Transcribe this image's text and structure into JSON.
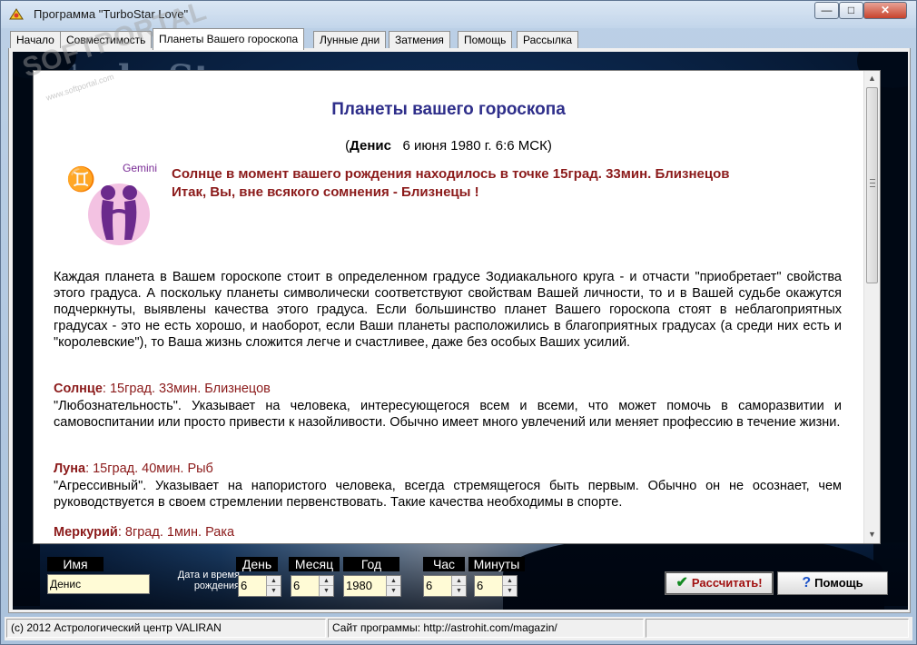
{
  "window": {
    "title": "Программа \"TurboStar Love\"",
    "buttons": {
      "minimize": "—",
      "maximize": "□",
      "close": "✕"
    }
  },
  "watermark": {
    "text": "SOFTPORTAL",
    "sub": "www.softportal.com"
  },
  "tabs": [
    {
      "label": "Начало"
    },
    {
      "label": "Совместимость"
    },
    {
      "label": "Планеты Вашего гороскопа"
    },
    {
      "label": "Лунные дни"
    },
    {
      "label": "Затмения"
    },
    {
      "label": "Помощь"
    },
    {
      "label": "Рассылка"
    }
  ],
  "active_tab": "Планеты Вашего гороскопа",
  "document": {
    "title": "Планеты вашего гороскопа",
    "person_prefix": "(",
    "person_name": "Денис",
    "person_details": "6 июня 1980 г. 6:6 МСК)",
    "sign_glyph": "♊",
    "sign_label": "Gemini",
    "sun_line1": "Солнце в момент вашего рождения находилось в точке 15град. 33мин. Близнецов",
    "sun_line2": "Итак, Вы, вне всякого сомнения - Близнецы !",
    "intro": "Каждая планета в Вашем гороскопе стоит в определенном градусе Зодиакального круга - и отчасти \"приобретает\" свойства этого градуса. А поскольку планеты символически соответствуют свойствам Вашей личности, то и в Вашей судьбе окажутся подчеркнуты, выявлены качества этого градуса. Если большинство планет Вашего гороскопа стоят в неблагоприятных градусах - это не есть хорошо, и наоборот, если Ваши планеты расположились в благоприятных градусах (а среди них есть и \"королевские\"), то Ваша жизнь сложится легче и счастливее, даже без особых Ваших усилий.",
    "planets": [
      {
        "name": "Солнце",
        "position": ": 15град. 33мин. Близнецов",
        "text": "\"Любознательность\". Указывает на человека, интересующегося всем и всеми, что может помочь в саморазвитии и самовоспитании или просто привести к назойливости. Обычно имеет много увлечений или меняет профессию в течение жизни."
      },
      {
        "name": "Луна",
        "position": ": 15град. 40мин. Рыб",
        "text": "\"Агрессивный\". Указывает на напористого человека, всегда стремящегося быть первым. Обычно он не осознает, чем руководствуется в своем стремлении первенствовать. Такие качества необходимы в спорте."
      },
      {
        "name": "Меркурий",
        "position": ": 8град. 1мин. Рака",
        "text": ""
      }
    ]
  },
  "form": {
    "name_label": "Имя",
    "name_value": "Денис",
    "datetime_label": "Дата и время рождения",
    "day_label": "День",
    "day_value": "6",
    "month_label": "Месяц",
    "month_value": "6",
    "year_label": "Год",
    "year_value": "1980",
    "hour_label": "Час",
    "hour_value": "6",
    "minute_label": "Минуты",
    "minute_value": "6",
    "calculate_label": "Рассчитать!",
    "help_label": "Помощь"
  },
  "status": {
    "copyright": "(c) 2012 Астрологический центр VALIRAN",
    "site_label": "Сайт программы:  http://astrohit.com/magazin/",
    "extra": ""
  },
  "colors": {
    "title_blue": "#2e2e8a",
    "planet_red": "#8b1a1a",
    "input_yellow": "#fffbd6"
  }
}
